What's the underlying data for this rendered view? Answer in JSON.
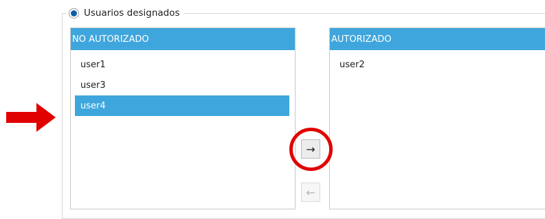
{
  "group": {
    "radio_label": "Usuarios designados",
    "radio_selected": true
  },
  "left_list": {
    "header": "NO AUTORIZADO",
    "items": [
      {
        "label": "user1",
        "selected": false
      },
      {
        "label": "user3",
        "selected": false
      },
      {
        "label": "user4",
        "selected": true
      }
    ]
  },
  "right_list": {
    "header": "AUTORIZADO",
    "items": [
      {
        "label": "user2",
        "selected": false
      }
    ]
  },
  "buttons": {
    "move_right": "→",
    "move_left": "←"
  },
  "annotations": {
    "color": "#e00000",
    "pointer_arrow_icon": "red-arrow-right-icon",
    "highlight_circle_icon": "red-circle-highlight"
  },
  "colors": {
    "header_bg": "#3fa6dd",
    "selection_bg": "#3fa6dd",
    "radio_dot": "#0f5fa8"
  }
}
